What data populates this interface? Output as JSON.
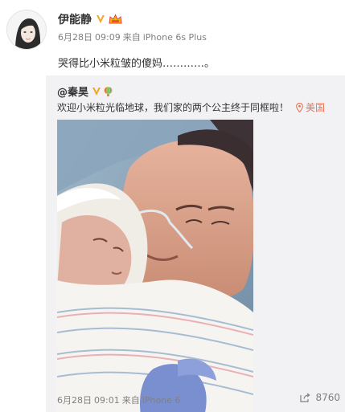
{
  "post": {
    "author": "伊能静",
    "date": "6月28日",
    "time": "09:09",
    "source_prefix": "来自",
    "source": "iPhone 6s Plus",
    "text": "哭得比小米粒皱的傻妈…………。",
    "avatar_icon": "avatar-photo",
    "badges": [
      "verified-v-icon",
      "crown-icon"
    ]
  },
  "repost": {
    "author": "@秦昊",
    "text": "欢迎小米粒光临地球，我们家的两个公主终于同框啦！",
    "location": "美国",
    "date": "6月28日",
    "time": "09:01",
    "source_prefix": "来自",
    "source": "iPhone 6",
    "share_count": "8760",
    "photo_icon": "newborn-photo",
    "badges": [
      "verified-v-icon",
      "rainbow-balloon-icon"
    ]
  },
  "colors": {
    "link": "#eb7350",
    "verified": "#f5a623",
    "repost_bg": "#f2f2f5",
    "meta_text": "#808080"
  }
}
